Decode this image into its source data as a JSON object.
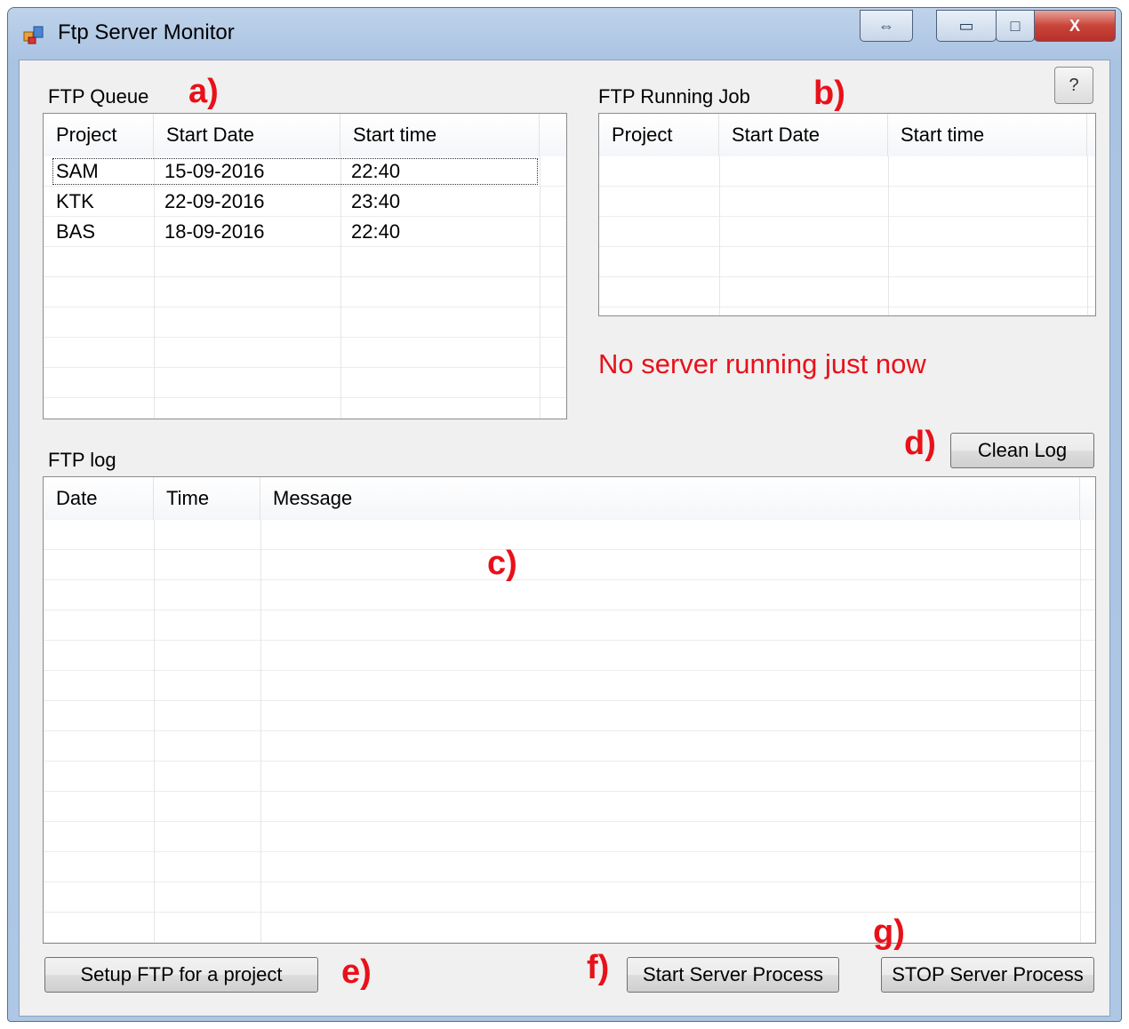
{
  "window": {
    "title": "Ftp Server Monitor"
  },
  "titlebar": {
    "restore_glyph": "⇔",
    "minimize_glyph": "▭",
    "maximize_glyph": "□",
    "close_glyph": "X"
  },
  "help_label": "?",
  "queue": {
    "label": "FTP Queue",
    "columns": [
      "Project",
      "Start Date",
      "Start time"
    ],
    "rows": [
      [
        "SAM",
        "15-09-2016",
        "22:40"
      ],
      [
        "KTK",
        "22-09-2016",
        "23:40"
      ],
      [
        "BAS",
        "18-09-2016",
        "22:40"
      ]
    ]
  },
  "running": {
    "label": "FTP Running Job",
    "columns": [
      "Project",
      "Start Date",
      "Start time"
    ],
    "status": "No server running just now"
  },
  "log": {
    "label": "FTP log",
    "columns": [
      "Date",
      "Time",
      "Message"
    ],
    "clean_button": "Clean Log"
  },
  "buttons": {
    "setup": "Setup FTP for a project",
    "start": "Start Server Process",
    "stop": "STOP Server Process"
  },
  "annotations": {
    "a": "a)",
    "b": "b)",
    "c": "c)",
    "d": "d)",
    "e": "e)",
    "f": "f)",
    "g": "g)"
  },
  "icons": {
    "app": "app-window-icon"
  },
  "colors": {
    "annotation": "#e8111a",
    "status": "#e8111a",
    "close_button": "#c9443a"
  }
}
